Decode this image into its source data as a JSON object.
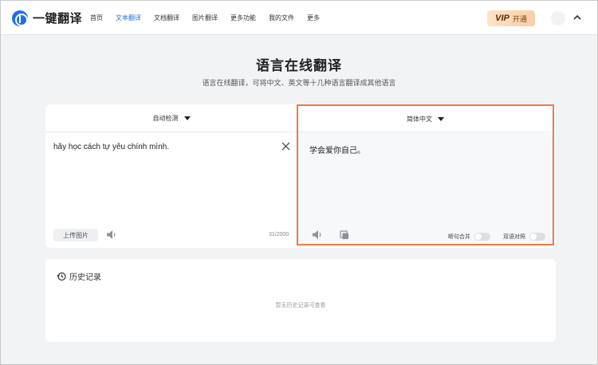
{
  "app": {
    "name": "一键翻译"
  },
  "nav": {
    "items": [
      {
        "label": "首页"
      },
      {
        "label": "文本翻译"
      },
      {
        "label": "文档翻译"
      },
      {
        "label": "图片翻译"
      },
      {
        "label": "更多功能"
      },
      {
        "label": "我的文件"
      },
      {
        "label": "更多"
      }
    ],
    "active_index": 1
  },
  "vip": {
    "badge": "VIP",
    "label": "开通"
  },
  "hero": {
    "title": "语言在线翻译",
    "subtitle": "语言在线翻译，可将中文、英文等十几种语言翻译成其他语言"
  },
  "source": {
    "language": "自动检测",
    "text": "hãy học cách tự yêu chính mình.",
    "upload_label": "上传图片",
    "char_count": "31/2000"
  },
  "target": {
    "language": "简体中文",
    "text": "学会爱你自己。",
    "options": [
      {
        "label": "断句合并",
        "enabled": false
      },
      {
        "label": "双语对照",
        "enabled": false
      }
    ]
  },
  "history": {
    "title": "历史记录",
    "empty_text": "暂无历史记录可查看"
  },
  "colors": {
    "accent": "#2a6fe0",
    "highlight_border": "#ec7a45",
    "page_bg": "#f2f3f5"
  },
  "icons": {
    "logo": "translate-globe-icon",
    "collapse": "chevron-up-icon",
    "swap": "swap-arrows-icon",
    "clear": "close-icon",
    "speaker": "speaker-icon",
    "copy": "copy-icon",
    "history": "history-clock-icon"
  }
}
